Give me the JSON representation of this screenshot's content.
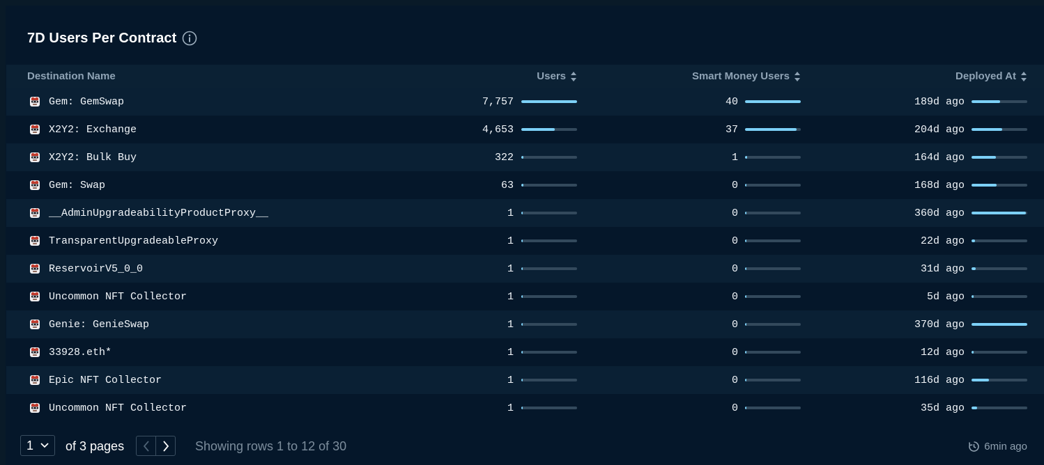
{
  "title": "7D Users Per Contract",
  "columns": {
    "name": "Destination Name",
    "users": "Users",
    "smart_money": "Smart Money Users",
    "deployed": "Deployed At"
  },
  "rows": [
    {
      "name": "Gem: GemSwap",
      "users": "7,757",
      "users_frac": 1.0,
      "smart": "40",
      "smart_frac": 1.0,
      "deployed": "189d ago",
      "deployed_frac": 0.51
    },
    {
      "name": "X2Y2: Exchange",
      "users": "4,653",
      "users_frac": 0.6,
      "smart": "37",
      "smart_frac": 0.925,
      "deployed": "204d ago",
      "deployed_frac": 0.55
    },
    {
      "name": "X2Y2: Bulk Buy",
      "users": "322",
      "users_frac": 0.042,
      "smart": "1",
      "smart_frac": 0.025,
      "deployed": "164d ago",
      "deployed_frac": 0.44
    },
    {
      "name": "Gem: Swap",
      "users": "63",
      "users_frac": 0.008,
      "smart": "0",
      "smart_frac": 0,
      "deployed": "168d ago",
      "deployed_frac": 0.45
    },
    {
      "name": "__AdminUpgradeabilityProductProxy__",
      "users": "1",
      "users_frac": 0,
      "smart": "0",
      "smart_frac": 0,
      "deployed": "360d ago",
      "deployed_frac": 0.97
    },
    {
      "name": "TransparentUpgradeableProxy",
      "users": "1",
      "users_frac": 0,
      "smart": "0",
      "smart_frac": 0,
      "deployed": "22d ago",
      "deployed_frac": 0.06
    },
    {
      "name": "ReservoirV5_0_0",
      "users": "1",
      "users_frac": 0,
      "smart": "0",
      "smart_frac": 0,
      "deployed": "31d ago",
      "deployed_frac": 0.08
    },
    {
      "name": "Uncommon NFT Collector",
      "users": "1",
      "users_frac": 0,
      "smart": "0",
      "smart_frac": 0,
      "deployed": "5d ago",
      "deployed_frac": 0.014
    },
    {
      "name": "Genie: GenieSwap",
      "users": "1",
      "users_frac": 0,
      "smart": "0",
      "smart_frac": 0,
      "deployed": "370d ago",
      "deployed_frac": 1.0
    },
    {
      "name": "33928.eth*",
      "users": "1",
      "users_frac": 0,
      "smart": "0",
      "smart_frac": 0,
      "deployed": "12d ago",
      "deployed_frac": 0.032
    },
    {
      "name": "Epic NFT Collector",
      "users": "1",
      "users_frac": 0,
      "smart": "0",
      "smart_frac": 0,
      "deployed": "116d ago",
      "deployed_frac": 0.31
    },
    {
      "name": "Uncommon NFT Collector",
      "users": "1",
      "users_frac": 0,
      "smart": "0",
      "smart_frac": 0,
      "deployed": "35d ago",
      "deployed_frac": 0.095
    }
  ],
  "pagination": {
    "current_page": "1",
    "of_pages": "of 3 pages",
    "showing": "Showing rows 1 to 12 of 30"
  },
  "updated": "6min ago",
  "colors": {
    "bar_fill": "#7cd0f7",
    "bar_track": "#33495c",
    "row_alt": "#0a2034",
    "background": "#05172a"
  },
  "icons": {
    "row_avatar": "contract-avatar-icon",
    "info": "info-icon",
    "sort": "sort-icon",
    "clock": "clock-refresh-icon"
  }
}
